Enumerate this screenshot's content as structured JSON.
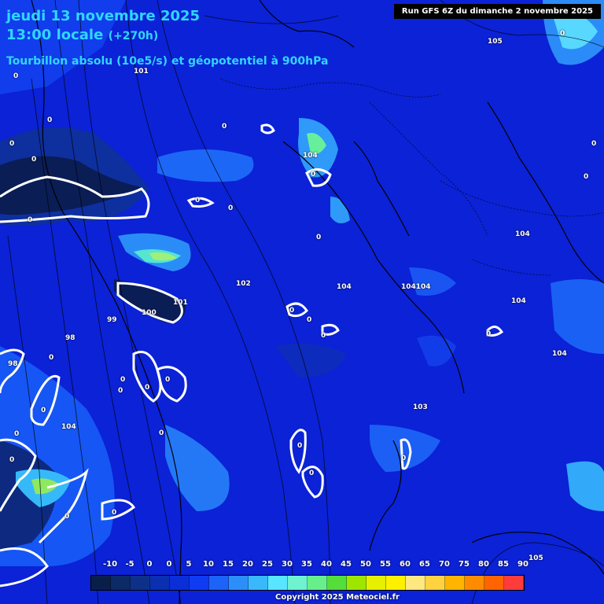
{
  "header": {
    "date_line": "jeudi 13 novembre 2025",
    "time_line": "13:00 locale",
    "forecast_hour": "(+270h)",
    "product": "Tourbillon absolu (10e5/s) et géopotentiel à 900hPa"
  },
  "run_info": "Run GFS 6Z du dimanche 2 novembre 2025",
  "copyright": "Copyright 2025 Meteociel.fr",
  "contour_labels": [
    "105",
    "101",
    "104",
    "104",
    "104",
    "104104",
    "104",
    "104",
    "103",
    "102",
    "101",
    "100",
    "99",
    "98",
    "98",
    "104",
    "104",
    "105"
  ],
  "zero_labels": [
    "0",
    "0",
    "0",
    "0",
    "0",
    "0",
    "0",
    "0",
    "0",
    "0",
    "0",
    "0",
    "0",
    "0",
    "0",
    "0",
    "0",
    "0",
    "0",
    "0",
    "0",
    "0",
    "0",
    "0",
    "0",
    "0",
    "0",
    "0",
    "0",
    "0",
    "0"
  ],
  "legend": {
    "labels": [
      "-10",
      "-5",
      "0",
      "0",
      "5",
      "10",
      "15",
      "20",
      "25",
      "30",
      "35",
      "40",
      "45",
      "50",
      "55",
      "60",
      "65",
      "70",
      "75",
      "80",
      "85",
      "90"
    ],
    "colors": [
      "#0a1e4a",
      "#0c2a66",
      "#0d3188",
      "#0a2fb0",
      "#0a2fd8",
      "#0f3cf2",
      "#1d63f7",
      "#2c8ef9",
      "#39b8fb",
      "#58e5ff",
      "#6ff2d0",
      "#67ef8c",
      "#54de3a",
      "#9ee600",
      "#e6f000",
      "#fff000",
      "#ffe880",
      "#ffd240",
      "#ffb400",
      "#ff8c00",
      "#ff6400",
      "#ff3c3c",
      "#f01818"
    ]
  },
  "colors": {
    "background": "#0a1fd0",
    "title_color": "#2fd6ff",
    "contour_color": "#000000",
    "zero_line_color": "#ffffff"
  }
}
